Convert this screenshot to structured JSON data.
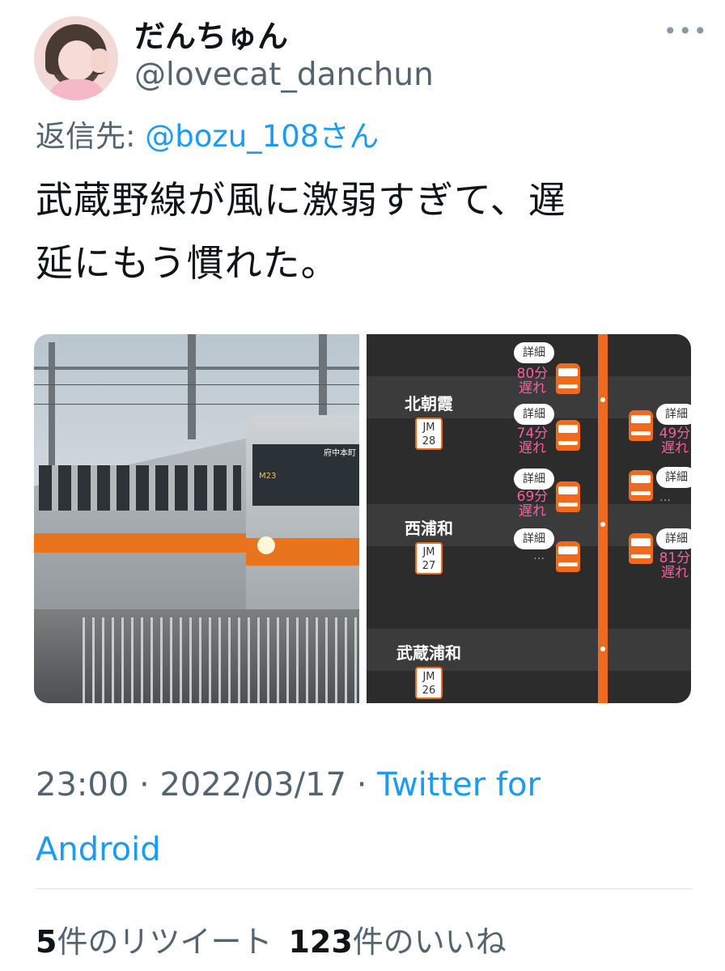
{
  "author": {
    "display_name": "だんちゅん",
    "handle": "@lovecat_danchun"
  },
  "more_icon": "more-horizontal-icon",
  "reply": {
    "prefix": "返信先: ",
    "mention": "@bozu_108さん"
  },
  "tweet": {
    "text_line1": "武蔵野線が風に激弱すぎて、遅",
    "text_line2": "延にもう慣れた。"
  },
  "media": {
    "photo": {
      "front_sign": "府中本町",
      "number": "M23"
    },
    "screen": {
      "stations": [
        {
          "name": "北朝霞",
          "code_prefix": "JM",
          "code_number": "28"
        },
        {
          "name": "西浦和",
          "code_prefix": "JM",
          "code_number": "27"
        },
        {
          "name": "武蔵浦和",
          "code_prefix": "JM",
          "code_number": "26"
        }
      ],
      "detail_label": "詳細",
      "delays_left": [
        "80分",
        "74分",
        "69分"
      ],
      "delays_right": [
        "49分",
        "81分"
      ],
      "delay_suffix": "遅れ",
      "ellipsis": "…"
    }
  },
  "meta": {
    "time": "23:00",
    "separator": " · ",
    "date": "2022/03/17",
    "source_line1": "Twitter for",
    "source_line2": "Android"
  },
  "stats": {
    "retweet_count": "5",
    "retweet_label": "件のリツイート",
    "like_count": "123",
    "like_label": "件のいいね"
  },
  "colors": {
    "link": "#1d9bf0",
    "secondary_text": "#536471",
    "line_orange": "#ef6a1c",
    "delay_pink": "#ff5a9e"
  }
}
